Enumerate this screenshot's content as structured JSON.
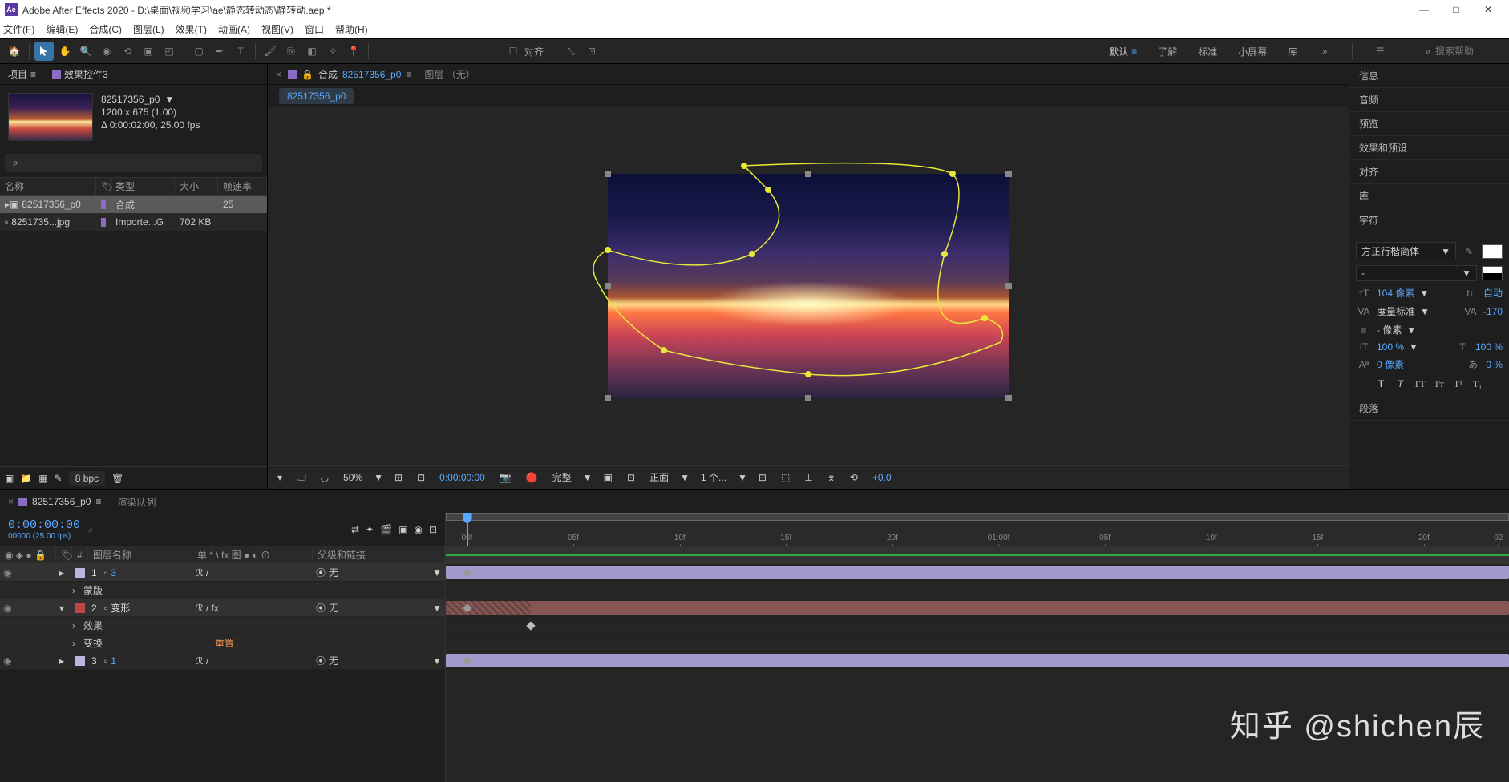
{
  "title": "Adobe After Effects 2020 - D:\\桌面\\视频学习\\ae\\静态转动态\\静转动.aep *",
  "menu": [
    "文件(F)",
    "编辑(E)",
    "合成(C)",
    "图层(L)",
    "效果(T)",
    "动画(A)",
    "视图(V)",
    "窗口",
    "帮助(H)"
  ],
  "workspaces": {
    "active": "默认",
    "items": [
      "默认",
      "了解",
      "标准",
      "小屏幕",
      "库"
    ]
  },
  "search_placeholder": "搜索帮助",
  "toolbar_snap": "对齐",
  "project_panel": {
    "tabs": {
      "project": "项目",
      "effect_controls": "效果控件3"
    },
    "comp_name": "82517356_p0",
    "dims": "1200 x 675 (1.00)",
    "dur": "Δ 0:00:02:00, 25.00 fps",
    "cols": {
      "name": "名称",
      "type": "类型",
      "size": "大小",
      "fps": "帧速率"
    },
    "rows": [
      {
        "name": "82517356_p0",
        "type": "合成",
        "size": "",
        "fps": "25"
      },
      {
        "name": "8251735...jpg",
        "type": "Importe...G",
        "size": "702 KB",
        "fps": ""
      }
    ],
    "bpc": "8 bpc"
  },
  "comp_panel": {
    "tab_label": "合成",
    "tab_id": "82517356_p0",
    "layer_tab": "图层 （无）",
    "breadcrumb": "82517356_p0",
    "footer": {
      "zoom": "50%",
      "time": "0:00:00:00",
      "res": "完整",
      "view": "正面",
      "views": "1 个...",
      "exposure": "+0.0"
    }
  },
  "right_panels": [
    "信息",
    "音频",
    "预览",
    "效果和预设",
    "对齐",
    "库",
    "字符"
  ],
  "char": {
    "font": "方正行楷简体",
    "size": "104 像素",
    "leading": "自动",
    "kerning": "度量标准",
    "tracking": "-170",
    "unit": "- 像素",
    "vscale": "100 %",
    "hscale": "100 %",
    "baseline": "0 像素",
    "tsume": "0 %"
  },
  "paragraph_label": "段落",
  "timeline": {
    "tab": "82517356_p0",
    "render_queue": "渲染队列",
    "timecode": "0:00:00:00",
    "timecode_sub": "00000 (25.00 fps)",
    "cols": {
      "layer_name": "图层名称",
      "switches": "单 * \\ fx 图 ● ◐ ⊙",
      "parent": "父级和链接"
    },
    "ruler": [
      "00f",
      "05f",
      "10f",
      "15f",
      "20f",
      "01:00f",
      "05f",
      "10f",
      "15f",
      "20f",
      "02"
    ],
    "layers": [
      {
        "num": "1",
        "name": "3",
        "color": "lav",
        "parent": "无"
      },
      {
        "prop": "蒙版"
      },
      {
        "num": "2",
        "name": "变形",
        "color": "red",
        "parent": "无",
        "fx": true
      },
      {
        "prop": "效果"
      },
      {
        "prop": "变换",
        "reset": "重置"
      },
      {
        "num": "3",
        "name": "1",
        "color": "lav",
        "parent": "无"
      }
    ]
  },
  "watermark": "知乎 @shichen辰"
}
